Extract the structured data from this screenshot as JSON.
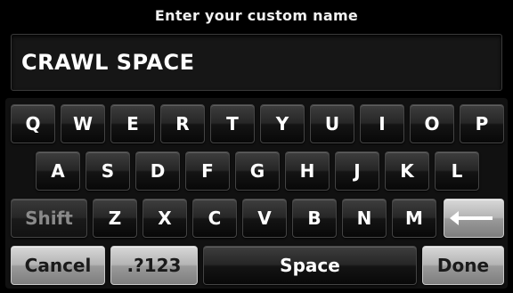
{
  "header": {
    "title": "Enter your custom name"
  },
  "name_field": {
    "value": "CRAWL SPACE"
  },
  "keyboard": {
    "row1": [
      "Q",
      "W",
      "E",
      "R",
      "T",
      "Y",
      "U",
      "I",
      "O",
      "P"
    ],
    "row2": [
      "A",
      "S",
      "D",
      "F",
      "G",
      "H",
      "J",
      "K",
      "L"
    ],
    "row3": [
      "Z",
      "X",
      "C",
      "V",
      "B",
      "N",
      "M"
    ],
    "shift_label": "Shift",
    "backspace_icon": "left-arrow-icon",
    "cancel_label": "Cancel",
    "symbols_label": ".?123",
    "space_label": "Space",
    "done_label": "Done"
  },
  "colors": {
    "background": "#000000",
    "key_dark": "#262626",
    "key_light": "#b4b4b4",
    "text": "#ffffff"
  }
}
